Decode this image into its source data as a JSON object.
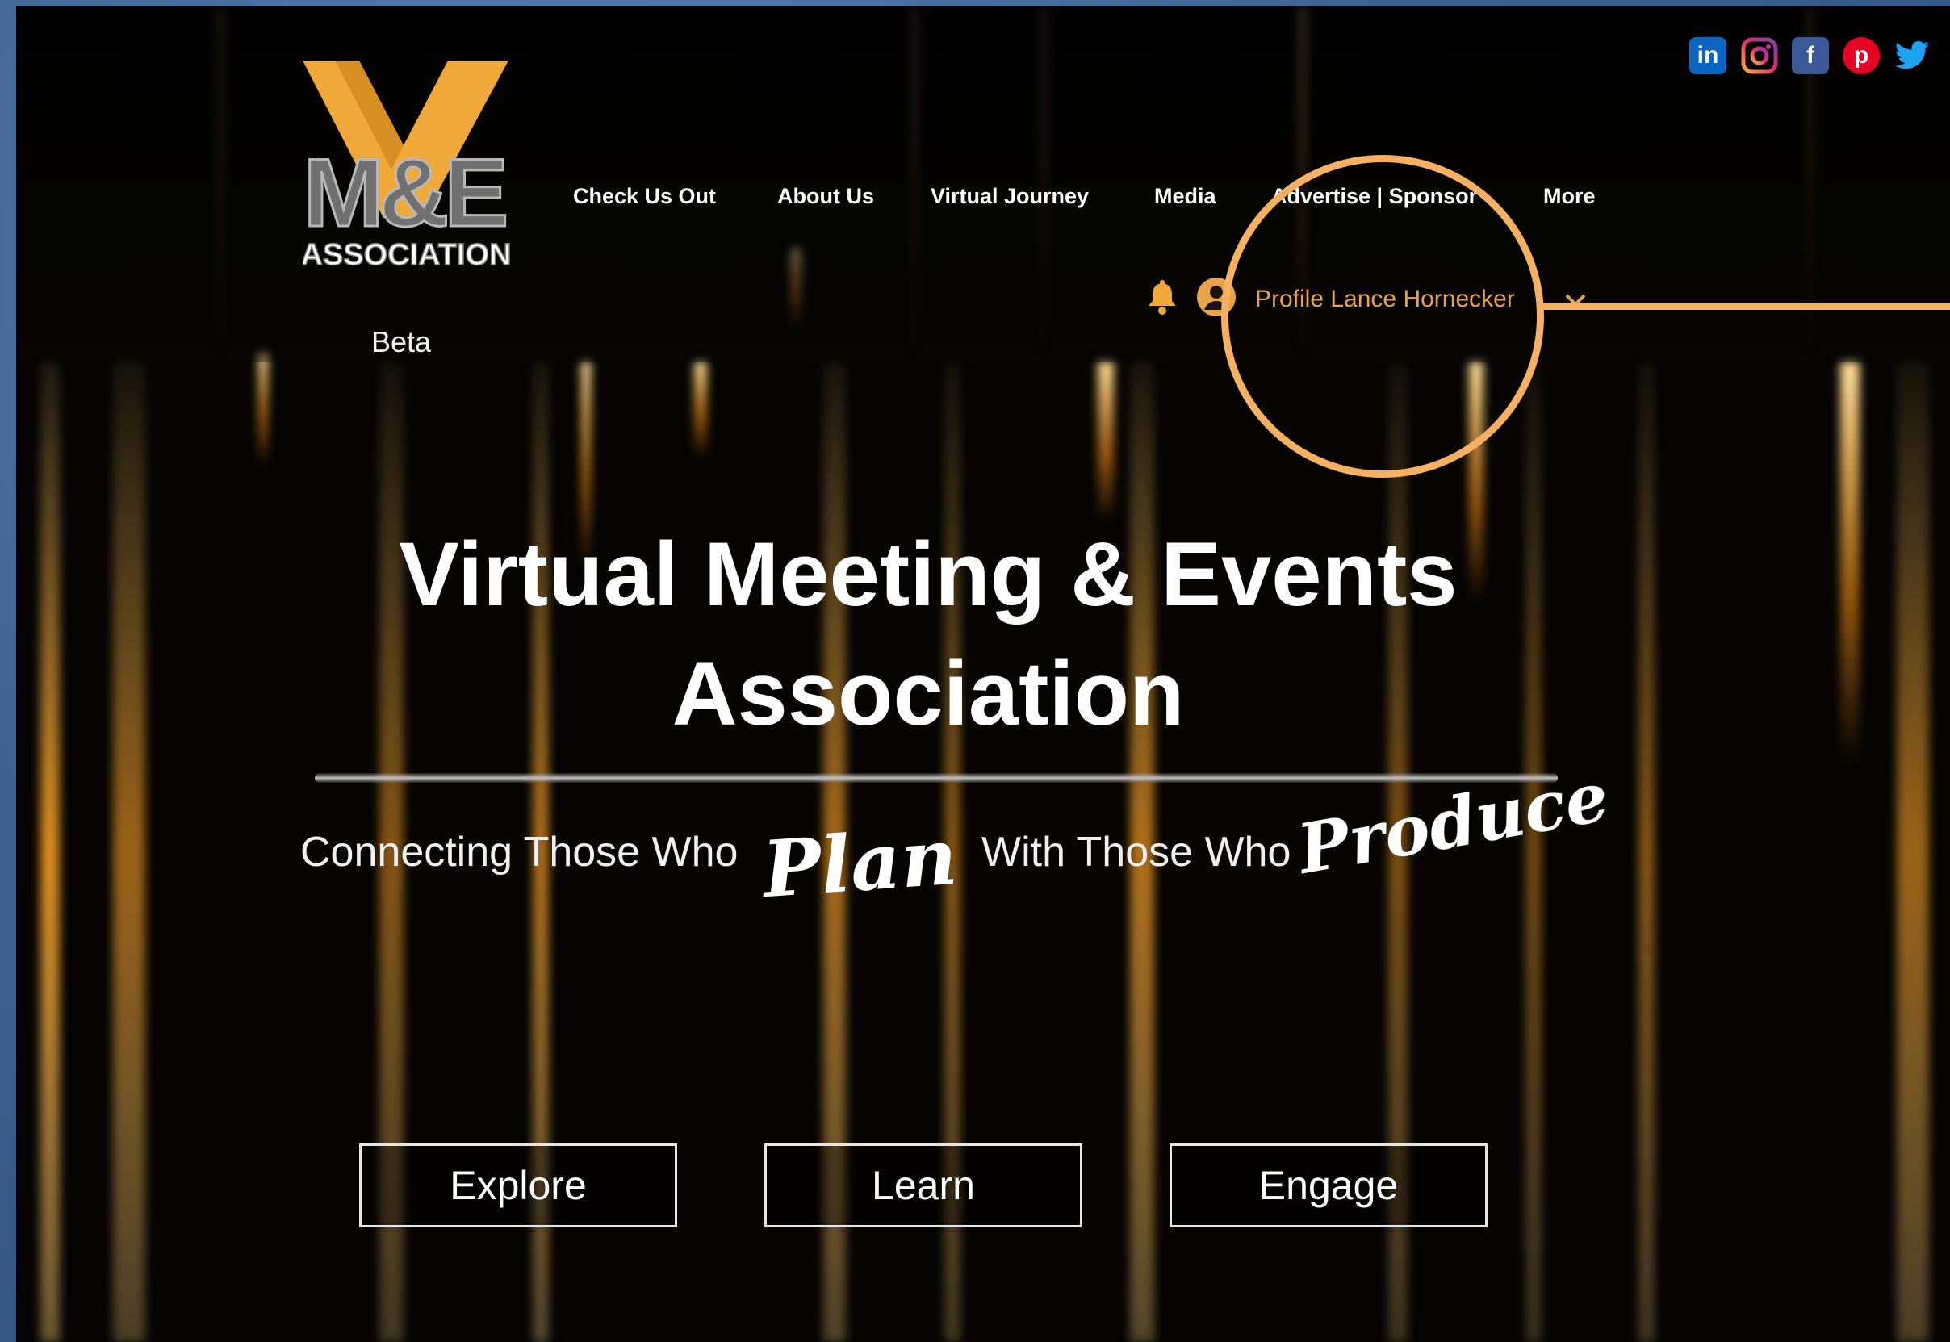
{
  "logo": {
    "letters_top": "V",
    "letters_mid": "M&E",
    "letters_bottom": "ASSOCIATION"
  },
  "beta_label": "Beta",
  "nav": {
    "items": [
      {
        "label": "Check Us Out"
      },
      {
        "label": "About Us"
      },
      {
        "label": "Virtual Journey"
      },
      {
        "label": "Media"
      },
      {
        "label": "Advertise | Sponsor"
      },
      {
        "label": "More"
      }
    ]
  },
  "social": {
    "icons": [
      "linkedin-icon",
      "instagram-icon",
      "facebook-icon",
      "pinterest-icon",
      "twitter-icon"
    ],
    "linkedin_text": "in",
    "facebook_text": "f",
    "pinterest_text": "p"
  },
  "profile": {
    "label": "Profile Lance Hornecker"
  },
  "hero": {
    "title_line1": "Virtual Meeting & Events",
    "title_line2": "Association",
    "tagline_part1": "Connecting Those Who",
    "tagline_script1": "Plan",
    "tagline_part2": "With Those Who",
    "tagline_script2": "Produce"
  },
  "buttons": {
    "explore": "Explore",
    "learn": "Learn",
    "engage": "Engage"
  },
  "colors": {
    "accent_orange": "#f6b062",
    "profile_text": "#e8a34a",
    "logo_orange": "#f0a838",
    "backdrop_blue": "#3e6391"
  }
}
